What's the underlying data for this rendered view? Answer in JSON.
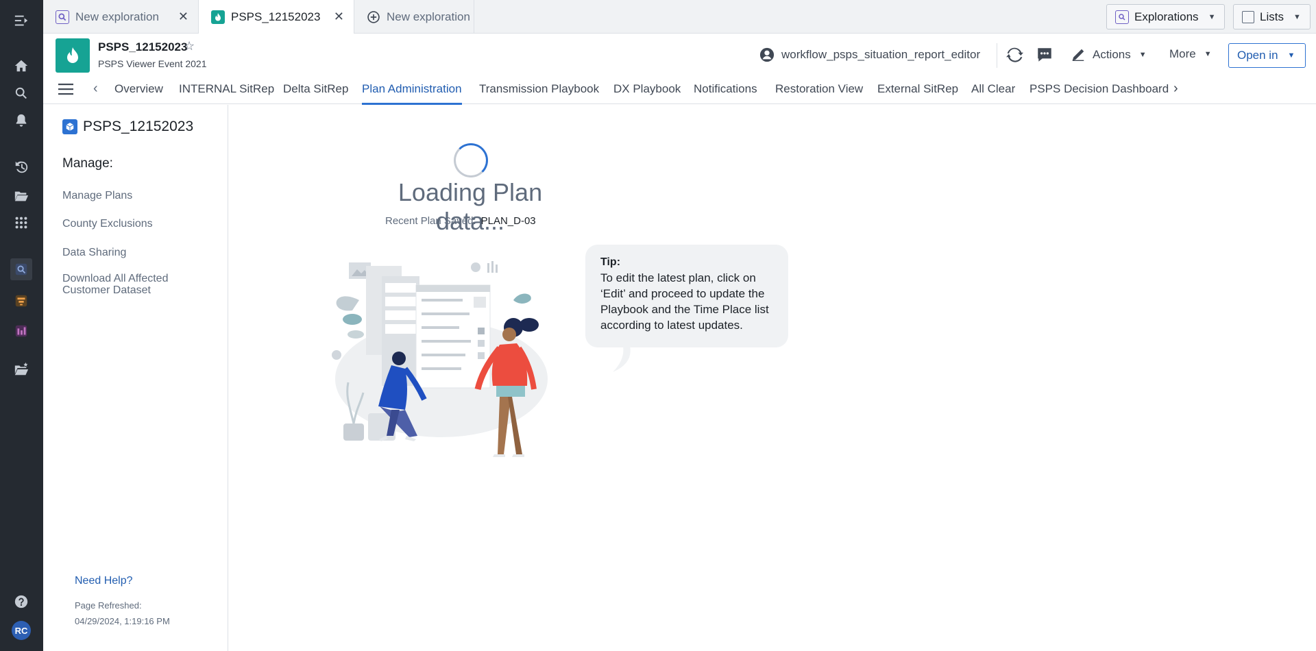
{
  "rail": {
    "avatar_initials": "RC"
  },
  "tabs": [
    {
      "label": "New exploration"
    },
    {
      "label": "PSPS_12152023"
    },
    {
      "label": "New exploration"
    }
  ],
  "top_buttons": {
    "explorations": "Explorations",
    "lists": "Lists"
  },
  "header": {
    "title": "PSPS_12152023",
    "subtitle": "PSPS Viewer Event 2021",
    "user": "workflow_psps_situation_report_editor",
    "actions": "Actions",
    "more": "More",
    "open_in": "Open in"
  },
  "nav_tabs": [
    "Overview",
    "INTERNAL SitRep",
    "Delta SitRep",
    "Plan Administration",
    "Transmission Playbook",
    "DX Playbook",
    "Notifications",
    "Restoration View",
    "External SitRep",
    "All Clear",
    "PSPS Decision Dashboard"
  ],
  "active_nav": "Plan Administration",
  "sidebar": {
    "title": "PSPS_12152023",
    "manage_label": "Manage:",
    "items": [
      "Manage Plans",
      "County Exclusions",
      "Data Sharing",
      "Download All Affected Customer Dataset"
    ],
    "help": "Need Help?",
    "refreshed_label": "Page Refreshed:",
    "refreshed_value": "04/29/2024, 1:19:16 PM"
  },
  "main": {
    "loading_text": "Loading  Plan data...",
    "recent_label": "Recent Plan Saved:",
    "recent_value": "PLAN_D-03",
    "tip_heading": "Tip:",
    "tip_body": "To edit the latest plan, click on ‘Edit’ and proceed to  update the Playbook and the Time Place list according to latest updates."
  },
  "colors": {
    "rail_bg": "#252a31",
    "accent": "#2d72d2",
    "brand_teal": "#16a394"
  }
}
